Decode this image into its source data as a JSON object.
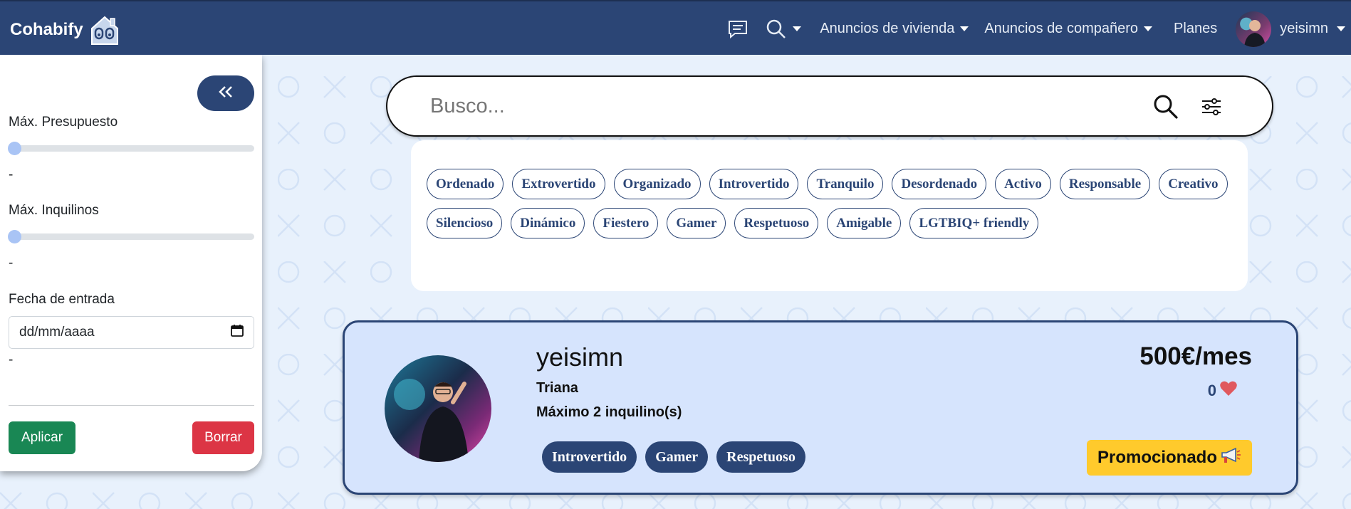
{
  "navbar": {
    "brand": "Cohabify",
    "items": [
      {
        "label": "Anuncios de vivienda"
      },
      {
        "label": "Anuncios de compañero"
      },
      {
        "label": "Planes"
      }
    ],
    "username": "yeisimn"
  },
  "sidebar": {
    "budget_label": "Máx. Presupuesto",
    "budget_value": "-",
    "tenants_label": "Máx. Inquilinos",
    "tenants_value": "-",
    "date_label": "Fecha de entrada",
    "date_placeholder": "dd/mm/aaaa",
    "date_value": "-",
    "apply_label": "Aplicar",
    "clear_label": "Borrar"
  },
  "search": {
    "placeholder": "Busco..."
  },
  "tags": [
    "Ordenado",
    "Extrovertido",
    "Organizado",
    "Introvertido",
    "Tranquilo",
    "Desordenado",
    "Activo",
    "Responsable",
    "Creativo",
    "Silencioso",
    "Dinámico",
    "Fiestero",
    "Gamer",
    "Respetuoso",
    "Amigable",
    "LGTBIQ+ friendly"
  ],
  "listing": {
    "name": "yeisimn",
    "area": "Triana",
    "max_tenants": "Máximo 2 inquilino(s)",
    "tags": [
      "Introvertido",
      "Gamer",
      "Respetuoso"
    ],
    "price": "500€/mes",
    "likes": "0",
    "promo_label": "Promocionado"
  },
  "colors": {
    "primary": "#2b4575",
    "background": "#e8f1fc",
    "card_bg": "#d6e4fd",
    "apply": "#198754",
    "clear": "#dc3545",
    "promo": "#ffca2c",
    "heart": "#e0585e"
  },
  "icons": {
    "chat": "chat-icon",
    "search": "search-icon",
    "filter": "sliders-icon",
    "collapse": "double-chevron-left-icon",
    "calendar": "calendar-icon",
    "heart": "heart-icon",
    "megaphone": "megaphone-icon"
  }
}
